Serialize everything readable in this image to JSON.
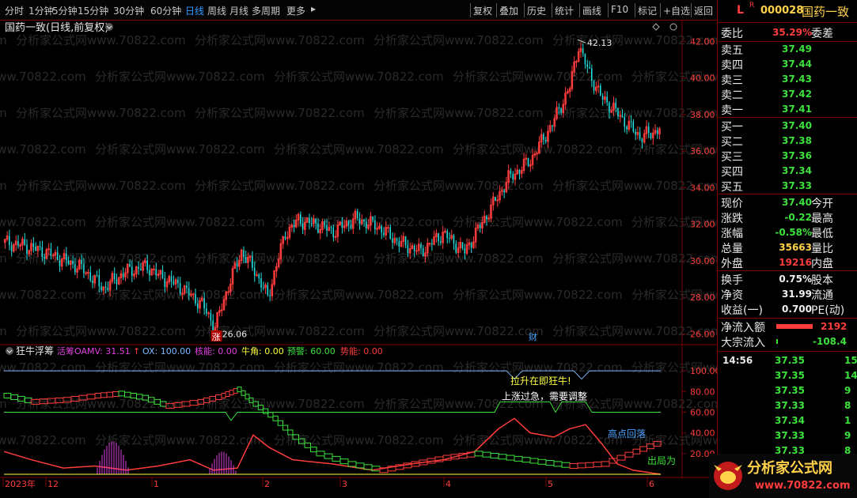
{
  "toolbar": {
    "left_items": [
      "分时",
      "1分钟",
      "5分钟",
      "15分钟",
      "30分钟",
      "60分钟",
      "日线",
      "周线",
      "月线",
      "多周期",
      "更多"
    ],
    "active_item": "日线",
    "right_items": [
      "复权",
      "叠加",
      "历史",
      "统计",
      "画线",
      "F10",
      "标记",
      "+自选",
      "返回"
    ]
  },
  "chart": {
    "title": "国药一致(日线,前复权)",
    "high_label": "42.13",
    "low_label": "26.06",
    "zhang_label": "涨",
    "cai_label": "财",
    "price_ticks": [
      "42.00",
      "40.00",
      "38.00",
      "36.00",
      "34.00",
      "32.00",
      "30.00",
      "28.00",
      "26.00"
    ],
    "watermark": "分析家公式网www.70822.com"
  },
  "indicator": {
    "name": "狂牛浮筹",
    "items": [
      {
        "label": "活筹OAMV: 31.51",
        "color": "#e040e0"
      },
      {
        "label": "↑",
        "color": "#ff3c3c"
      },
      {
        "label": "OX: 100.00",
        "color": "#7fb7ff"
      },
      {
        "label": "核能: 0.00",
        "color": "#e040e0"
      },
      {
        "label": "牛角: 0.00",
        "color": "#ffff40"
      },
      {
        "label": "预警: 60.00",
        "color": "#3ce13c"
      },
      {
        "label": "势能: 0.00",
        "color": "#ff3c3c"
      }
    ],
    "ticks": [
      "100.00",
      "80.00",
      "60.00",
      "40.00",
      "20.00"
    ],
    "annotations": {
      "rise_label": "拉升在即狂牛!",
      "warn_label": "上涨过急，需要调整",
      "top_label": "高点回落",
      "exit_label": "出局为"
    }
  },
  "time_axis": {
    "labels": [
      "2023年",
      "12",
      "1",
      "2",
      "3",
      "4",
      "5",
      "6"
    ]
  },
  "quote": {
    "flag": "L",
    "flag2": "R",
    "code": "000028",
    "name": "国药一致",
    "weibi_label": "委比",
    "weibi_value": "35.29%",
    "weicha_label": "委差",
    "asks": [
      {
        "label": "卖五",
        "price": "37.49"
      },
      {
        "label": "卖四",
        "price": "37.44"
      },
      {
        "label": "卖三",
        "price": "37.43"
      },
      {
        "label": "卖二",
        "price": "37.42"
      },
      {
        "label": "卖一",
        "price": "37.41"
      }
    ],
    "bids": [
      {
        "label": "买一",
        "price": "37.40"
      },
      {
        "label": "买二",
        "price": "37.38"
      },
      {
        "label": "买三",
        "price": "37.36"
      },
      {
        "label": "买四",
        "price": "37.34"
      },
      {
        "label": "买五",
        "price": "37.33"
      }
    ],
    "stats": [
      {
        "label": "现价",
        "value": "37.40",
        "color": "green",
        "label2": "今开"
      },
      {
        "label": "涨跌",
        "value": "-0.22",
        "color": "green",
        "label2": "最高"
      },
      {
        "label": "涨幅",
        "value": "-0.58%",
        "color": "green",
        "label2": "最低"
      },
      {
        "label": "总量",
        "value": "35663",
        "color": "yellow",
        "label2": "量比"
      },
      {
        "label": "外盘",
        "value": "19216",
        "color": "red",
        "label2": "内盘"
      }
    ],
    "stats2": [
      {
        "label": "换手",
        "value": "0.75%",
        "label2": "股本"
      },
      {
        "label": "净资",
        "value": "31.99",
        "label2": "流通"
      },
      {
        "label": "收益(一)",
        "value": "0.700",
        "label2": "PE(动)"
      }
    ],
    "flow": [
      {
        "label": "净流入额",
        "value": "2192",
        "color": "red"
      },
      {
        "label": "大宗流入",
        "value": "-108.4",
        "color": "green"
      }
    ],
    "ticks": [
      {
        "time": "14:56",
        "price": "37.35",
        "vol": "15"
      },
      {
        "time": "",
        "price": "37.35",
        "vol": "14"
      },
      {
        "time": "",
        "price": "37.35",
        "vol": "9"
      },
      {
        "time": "",
        "price": "37.33",
        "vol": "8"
      },
      {
        "time": "",
        "price": "37.34",
        "vol": "1"
      },
      {
        "time": "",
        "price": "37.33",
        "vol": "9"
      },
      {
        "time": "",
        "price": "37.33",
        "vol": "8"
      }
    ]
  },
  "logo": {
    "text": "分析家公式网",
    "url": "www.70822.com"
  },
  "colors": {
    "up": "#ff3c3c",
    "down": "#22e0e0",
    "grid": "#7a0000",
    "ma_green": "#3ce13c",
    "ox_blue": "#7fb7ff",
    "magenta": "#e040e0"
  }
}
